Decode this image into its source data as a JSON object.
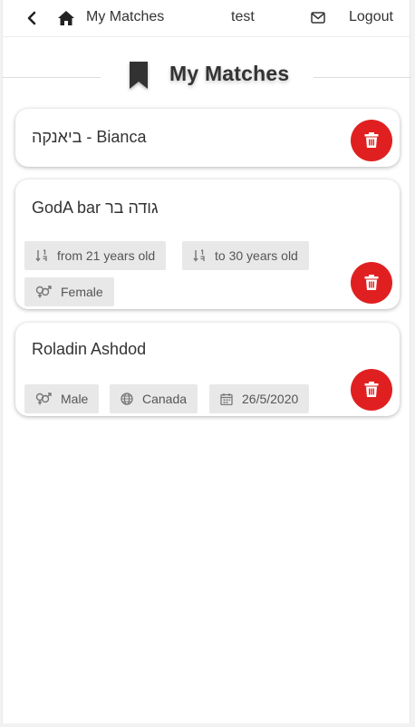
{
  "header": {
    "nav_title": "My Matches",
    "user_name": "test",
    "logout_label": "Logout"
  },
  "page": {
    "title": "My Matches"
  },
  "matches": [
    {
      "name": "ביאנקה - Bianca",
      "chips": []
    },
    {
      "name": "GodA bar גודה בר",
      "chips": [
        {
          "icon": "sort-numeric-icon",
          "label": "from 21 years old"
        },
        {
          "icon": "sort-numeric-icon",
          "label": "to 30 years old"
        },
        {
          "icon": "gender-icon",
          "label": "Female"
        }
      ]
    },
    {
      "name": "Roladin Ashdod",
      "chips": [
        {
          "icon": "gender-icon",
          "label": "Male"
        },
        {
          "icon": "globe-icon",
          "label": "Canada"
        },
        {
          "icon": "calendar-icon",
          "label": "26/5/2020"
        }
      ]
    }
  ],
  "colors": {
    "delete": "#e02020",
    "chip_bg": "#e8e8e8"
  }
}
